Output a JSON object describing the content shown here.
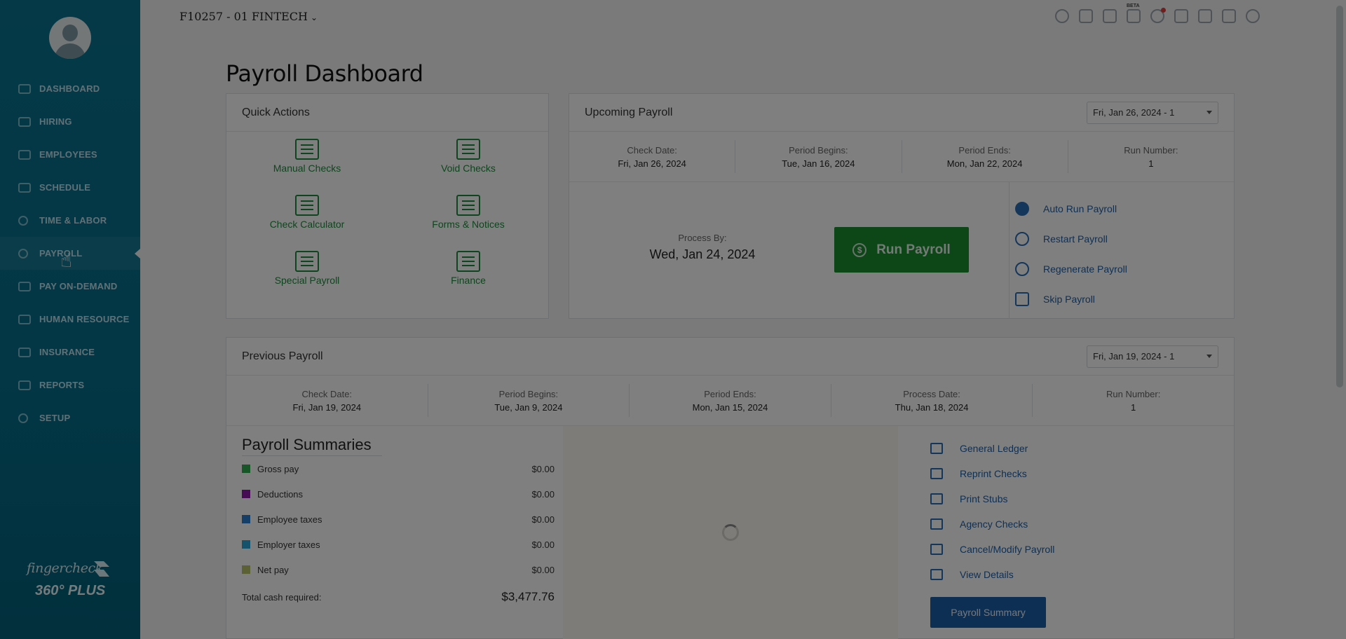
{
  "header": {
    "company": "F10257 - 01 FINTECH",
    "page_title": "Payroll Dashboard"
  },
  "top_icons": [
    "search-icon",
    "trash-icon",
    "megaphone-icon",
    "beta-icon",
    "bell-icon",
    "contacts-icon",
    "video-icon",
    "upload-icon",
    "help-icon"
  ],
  "beta_label": "BETA",
  "sidebar": {
    "items": [
      {
        "label": "DASHBOARD",
        "icon": "dashboard-icon"
      },
      {
        "label": "HIRING",
        "icon": "briefcase-icon"
      },
      {
        "label": "EMPLOYEES",
        "icon": "employees-icon"
      },
      {
        "label": "SCHEDULE",
        "icon": "calendar-icon"
      },
      {
        "label": "TIME & LABOR",
        "icon": "clock-icon"
      },
      {
        "label": "PAYROLL",
        "icon": "payroll-icon"
      },
      {
        "label": "PAY ON-DEMAND",
        "icon": "wallet-icon"
      },
      {
        "label": "HUMAN RESOURCE",
        "icon": "people-icon"
      },
      {
        "label": "INSURANCE",
        "icon": "umbrella-icon"
      },
      {
        "label": "REPORTS",
        "icon": "reports-icon"
      },
      {
        "label": "SETUP",
        "icon": "gear-icon"
      }
    ],
    "active": "PAYROLL",
    "brand": {
      "name": "fingercheck",
      "tier": "360° PLUS"
    }
  },
  "quick_actions": {
    "title": "Quick Actions",
    "items": [
      "Manual Checks",
      "Void Checks",
      "Check Calculator",
      "Forms & Notices",
      "Special Payroll",
      "Finance"
    ]
  },
  "upcoming": {
    "title": "Upcoming Payroll",
    "select": "Fri, Jan 26, 2024 - 1",
    "stats": [
      {
        "label": "Check Date:",
        "value": "Fri, Jan 26, 2024"
      },
      {
        "label": "Period Begins:",
        "value": "Tue, Jan 16, 2024"
      },
      {
        "label": "Period Ends:",
        "value": "Mon, Jan 22, 2024"
      },
      {
        "label": "Run Number:",
        "value": "1"
      }
    ],
    "process_by_label": "Process By:",
    "process_by_value": "Wed, Jan 24, 2024",
    "run_button": "Run Payroll",
    "actions": [
      "Auto Run Payroll",
      "Restart Payroll",
      "Regenerate Payroll",
      "Skip Payroll"
    ]
  },
  "previous": {
    "title": "Previous Payroll",
    "select": "Fri, Jan 19, 2024 - 1",
    "stats": [
      {
        "label": "Check Date:",
        "value": "Fri, Jan 19, 2024"
      },
      {
        "label": "Period Begins:",
        "value": "Tue, Jan 9, 2024"
      },
      {
        "label": "Period Ends:",
        "value": "Mon, Jan 15, 2024"
      },
      {
        "label": "Process Date:",
        "value": "Thu, Jan 18, 2024"
      },
      {
        "label": "Run Number:",
        "value": "1"
      }
    ],
    "summaries_title": "Payroll Summaries",
    "summaries": [
      {
        "label": "Gross pay",
        "amount": "$0.00",
        "color": "#2fae4e"
      },
      {
        "label": "Deductions",
        "amount": "$0.00",
        "color": "#8e1aa8"
      },
      {
        "label": "Employee taxes",
        "amount": "$0.00",
        "color": "#2b7fd1"
      },
      {
        "label": "Employer taxes",
        "amount": "$0.00",
        "color": "#2aa6d9"
      },
      {
        "label": "Net pay",
        "amount": "$0.00",
        "color": "#b9c06a"
      }
    ],
    "total_label": "Total cash required:",
    "total_amount": "$3,477.76",
    "actions": [
      "General Ledger",
      "Reprint Checks",
      "Print Stubs",
      "Agency Checks",
      "Cancel/Modify Payroll",
      "View Details"
    ],
    "summary_button": "Payroll Summary"
  }
}
